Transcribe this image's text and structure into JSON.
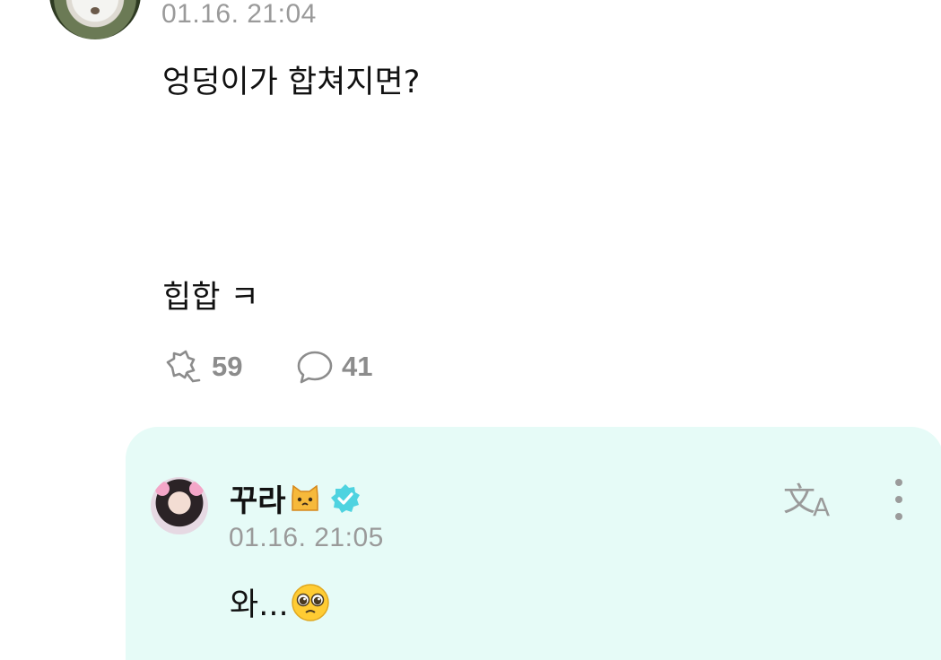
{
  "post": {
    "timestamp": "01.16. 21:04",
    "text_line1": "엉덩이가 합쳐지면?",
    "text_line2": "힙합 ㅋ",
    "repost_count": "59",
    "comment_count": "41"
  },
  "reply": {
    "name": "꾸라",
    "timestamp": "01.16. 21:05",
    "text": "와...",
    "icons": [
      "cat-emoji",
      "verified-badge",
      "translate-icon",
      "more-icon",
      "pleading-face-emoji"
    ]
  },
  "colors": {
    "reply_background": "#e6fbf7",
    "verified": "#4fd3e0",
    "meta_gray": "#9a9a9a"
  }
}
